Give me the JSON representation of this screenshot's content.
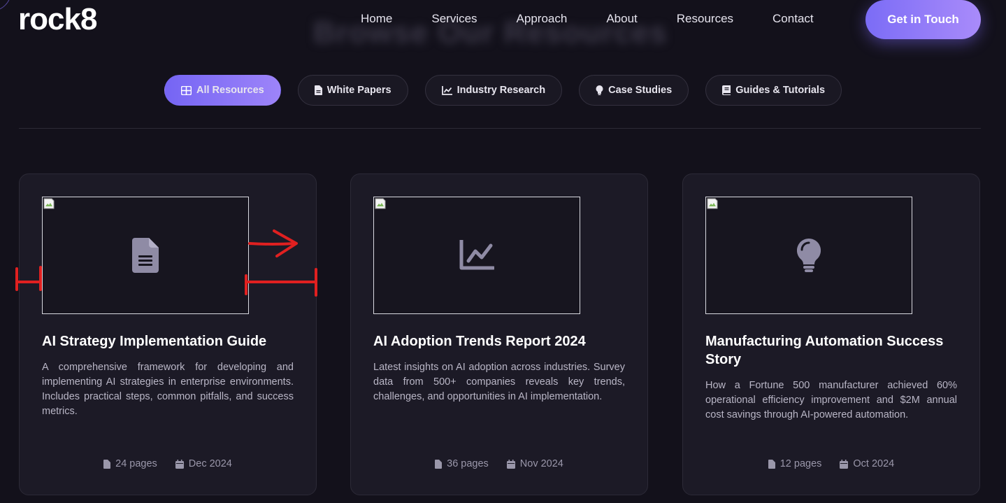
{
  "header": {
    "logo": "rock8",
    "nav": [
      "Home",
      "Services",
      "Approach",
      "About",
      "Resources",
      "Contact"
    ],
    "cta": "Get in Touch"
  },
  "hero": {
    "blurred_heading": "Browse Our Resources"
  },
  "filters": [
    {
      "label": "All Resources",
      "icon": "grid-icon",
      "active": true
    },
    {
      "label": "White Papers",
      "icon": "file-icon",
      "active": false
    },
    {
      "label": "Industry Research",
      "icon": "chart-line-icon",
      "active": false
    },
    {
      "label": "Case Studies",
      "icon": "lightbulb-icon",
      "active": false
    },
    {
      "label": "Guides & Tutorials",
      "icon": "book-icon",
      "active": false
    }
  ],
  "cards": [
    {
      "title": "AI Strategy Implementation Guide",
      "description": "A comprehensive framework for developing and implementing AI strategies in enterprise environments. Includes practical steps, common pitfalls, and success metrics.",
      "pages": "24 pages",
      "date": "Dec 2024",
      "icon": "file-icon"
    },
    {
      "title": "AI Adoption Trends Report 2024",
      "description": "Latest insights on AI adoption across industries. Survey data from 500+ companies reveals key trends, challenges, and opportunities in AI implementation.",
      "pages": "36 pages",
      "date": "Nov 2024",
      "icon": "chart-line-icon"
    },
    {
      "title": "Manufacturing Automation Success Story",
      "description": "How a Fortune 500 manufacturer achieved 60% operational efficiency improvement and $2M annual cost savings through AI-powered automation.",
      "pages": "12 pages",
      "date": "Oct 2024",
      "icon": "lightbulb-icon"
    }
  ],
  "colors": {
    "background": "#13111b",
    "card": "#1c1a26",
    "accent_start": "#7565f4",
    "accent_end": "#a98bfa",
    "annotation": "#e02020",
    "icon_muted": "#8f8ba5"
  }
}
